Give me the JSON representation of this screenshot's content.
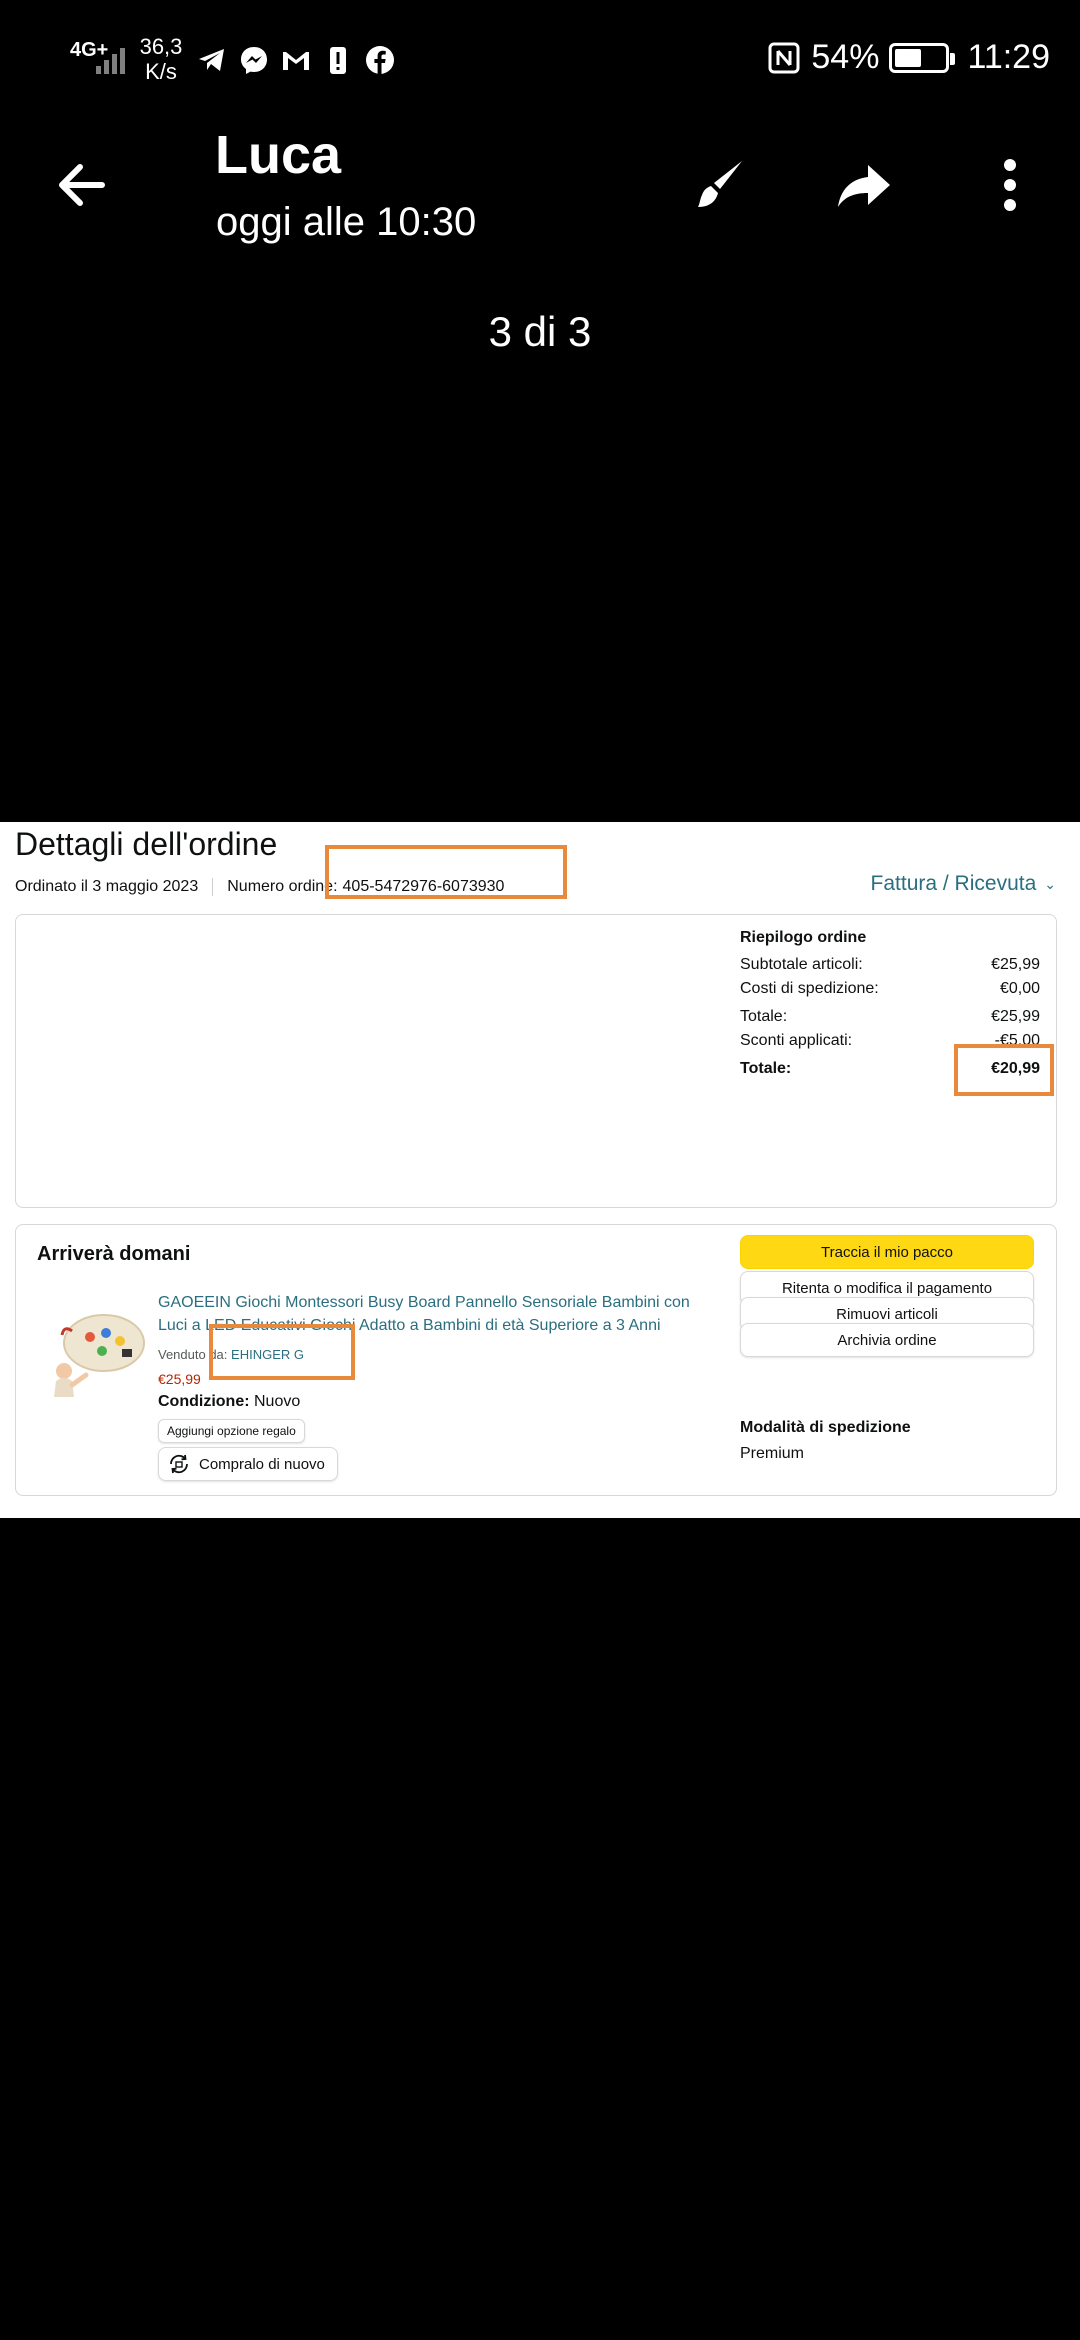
{
  "status_bar": {
    "network": "4G+",
    "speed_value": "36,3",
    "speed_unit": "K/s",
    "notification_icons": [
      "telegram-icon",
      "messenger-icon",
      "gmail-icon",
      "alert-icon",
      "facebook-icon"
    ],
    "nfc_icon": "nfc-icon",
    "battery_percent": "54%",
    "battery_level": 0.54,
    "time": "11:29"
  },
  "viewer": {
    "title": "Luca",
    "subtitle": "oggi alle 10:30",
    "counter": "3 di 3",
    "icons": [
      "back-arrow-icon",
      "brush-icon",
      "share-icon",
      "more-vertical-icon"
    ]
  },
  "order": {
    "heading": "Dettagli dell'ordine",
    "ordered_on": "Ordinato il 3 maggio 2023",
    "order_number_label": "Numero ordine:",
    "order_number": "405-5472976-6073930",
    "invoice_link": "Fattura / Ricevuta",
    "summary": {
      "title": "Riepilogo ordine",
      "rows": [
        {
          "label": "Subtotale articoli:",
          "value": "€25,99"
        },
        {
          "label": "Costi di spedizione:",
          "value": "€0,00"
        },
        {
          "label": "Totale:",
          "value": "€25,99"
        },
        {
          "label": "Sconti applicati:",
          "value": "-€5,00"
        }
      ],
      "grand_total_label": "Totale:",
      "grand_total": "€20,99"
    },
    "shipment": {
      "arrival": "Arriverà domani",
      "product_title": "GAOEEIN Giochi Montessori Busy Board Pannello Sensoriale Bambini con Luci a LED Educativi Giochi Adatto a Bambini di età Superiore a 3 Anni",
      "sold_by_label": "Venduto da:",
      "seller": "EHINGER G",
      "price": "€25,99",
      "condition_label": "Condizione:",
      "condition": "Nuovo",
      "gift_option": "Aggiungi opzione regalo",
      "buy_again": "Compralo di nuovo",
      "buttons": {
        "track": "Traccia il mio pacco",
        "payment": "Ritenta o modifica il pagamento",
        "remove": "Rimuovi articoli",
        "archive": "Archivia ordine"
      },
      "shipping_method_label": "Modalità di spedizione",
      "shipping_method": "Premium"
    },
    "colors": {
      "link": "#2a6f7f",
      "highlight": "#e8893c",
      "primary_button": "#ffd814",
      "price": "#b12704"
    }
  }
}
